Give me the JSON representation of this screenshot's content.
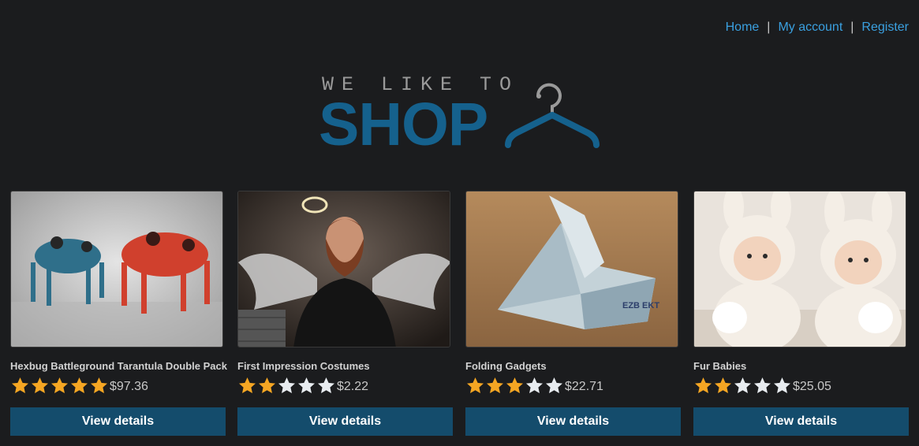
{
  "nav": {
    "links": [
      "Home",
      "My account",
      "Register"
    ],
    "separator": "|"
  },
  "logo": {
    "tagline": "WE LIKE TO",
    "word": "SHOP",
    "icon": "hanger-icon"
  },
  "colors": {
    "background": "#1b1c1e",
    "link": "#3aa0e0",
    "brand": "#15618d",
    "button": "#144c6c",
    "star_filled": "#f5a623",
    "star_empty": "#e8ecf0"
  },
  "products": [
    {
      "name": "Hexbug Battleground Tarantula Double Pack",
      "rating": 5,
      "max_rating": 5,
      "price": "$97.36",
      "button": "View details",
      "image": "robot-spiders-photo"
    },
    {
      "name": "First Impression Costumes",
      "rating": 2,
      "max_rating": 5,
      "price": "$2.22",
      "button": "View details",
      "image": "angel-man-photo"
    },
    {
      "name": "Folding Gadgets",
      "rating": 3,
      "max_rating": 5,
      "price": "$22.71",
      "button": "View details",
      "image": "origami-banknote-photo"
    },
    {
      "name": "Fur Babies",
      "rating": 2,
      "max_rating": 5,
      "price": "$25.05",
      "button": "View details",
      "image": "babies-bunny-hats-photo"
    }
  ]
}
